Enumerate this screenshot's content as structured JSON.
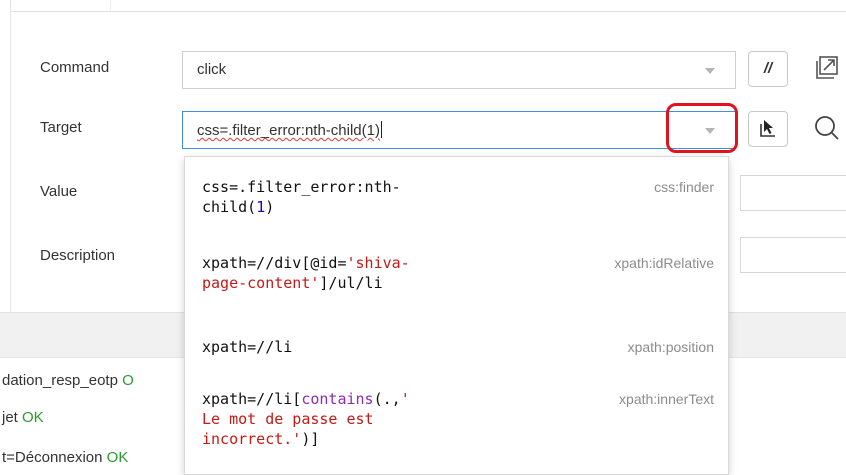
{
  "form": {
    "command": {
      "label": "Command",
      "value": "click"
    },
    "target": {
      "label": "Target",
      "value": "css=.filter_error:nth-child(1)"
    },
    "value": {
      "label": "Value"
    },
    "description": {
      "label": "Description"
    },
    "comment_button_label": "//"
  },
  "target_suggestions": [
    {
      "line1": "css=.filter_error:nth-",
      "line2": "child(1)",
      "type": "css:finder"
    },
    {
      "line1": "xpath=//div[@id='shiva-",
      "line2": "page-content']/ul/li",
      "type": "xpath:idRelative"
    },
    {
      "line1": "xpath=//li",
      "type": "xpath:position"
    },
    {
      "line1": "xpath=//li[contains(.,'",
      "line2": "Le mot de passe est",
      "line3": "incorrect.')]",
      "type": "xpath:innerText"
    }
  ],
  "log": {
    "lines": [
      {
        "text": "dation_resp_eotp ",
        "status": "O"
      },
      {
        "text": "jet ",
        "status": "OK"
      },
      {
        "text": "t=Déconnexion ",
        "status": "OK"
      }
    ]
  },
  "colors": {
    "highlight": "#e0141e",
    "focus_border": "#3f8fdc",
    "ok": "#2c9a2c",
    "code_string": "#c41a16",
    "code_function": "#8c2bb3",
    "code_number": "#1c00cf"
  },
  "icons": {
    "open_in_new": "open-in-new-icon",
    "select_target": "select-target-icon",
    "find_target": "search-icon",
    "dropdown_caret": "chevron-down-icon"
  }
}
